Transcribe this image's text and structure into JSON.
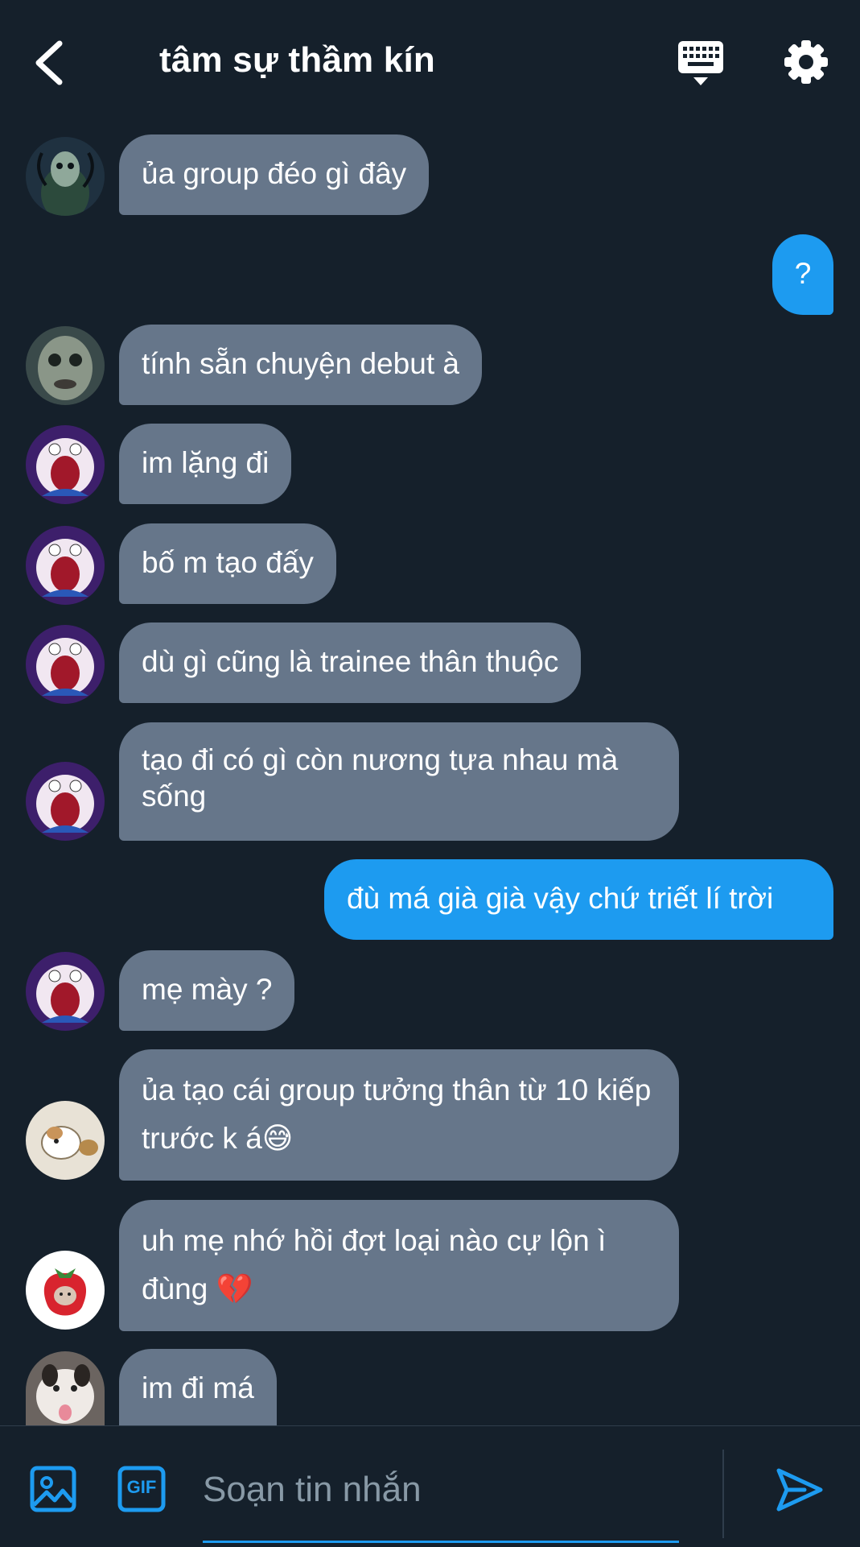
{
  "header": {
    "back_icon": "chevron-left-icon",
    "title": "tâm sự thầm kín",
    "keyboard_icon": "keyboard-icon",
    "settings_icon": "gear-icon"
  },
  "messages": [
    {
      "direction": "in",
      "text": "ủa group đéo gì đây",
      "avatar": "green-creature"
    },
    {
      "direction": "out",
      "text": "?"
    },
    {
      "direction": "in",
      "text": "tính sẵn chuyện debut à",
      "avatar": "fish-face"
    },
    {
      "direction": "in",
      "text": "im lặng đi",
      "avatar": "doraemon-screaming"
    },
    {
      "direction": "in",
      "text": "bố m tạo đấy",
      "avatar": "doraemon-screaming"
    },
    {
      "direction": "in",
      "text": "dù gì cũng là trainee thân thuộc",
      "avatar": "doraemon-screaming"
    },
    {
      "direction": "in",
      "text": "tạo đi có gì còn nương tựa nhau mà sống",
      "avatar": "doraemon-screaming"
    },
    {
      "direction": "out",
      "text": "đù má già già vậy chứ triết lí trời"
    },
    {
      "direction": "in",
      "text": "mẹ mày ?",
      "avatar": "doraemon-screaming"
    },
    {
      "direction": "in",
      "text": "ủa tạo cái group tưởng thân từ 10 kiếp trước k á😅",
      "avatar": "hamster"
    },
    {
      "direction": "in",
      "text": "uh mẹ nhớ hồi đợt loại nào cự lộn ì đùng 💔",
      "avatar": "strawberry-cat"
    },
    {
      "direction": "in",
      "text": "im đi má",
      "avatar": "cat-tongue"
    }
  ],
  "composer": {
    "image_icon": "image-icon",
    "gif_icon": "gif-icon",
    "gif_label": "GIF",
    "placeholder": "Soạn tin nhắn",
    "value": "",
    "send_icon": "send-icon"
  },
  "colors": {
    "background": "#15202b",
    "incoming_bubble": "#66768a",
    "outgoing_bubble": "#1d9bf0",
    "accent": "#1d9bf0"
  }
}
